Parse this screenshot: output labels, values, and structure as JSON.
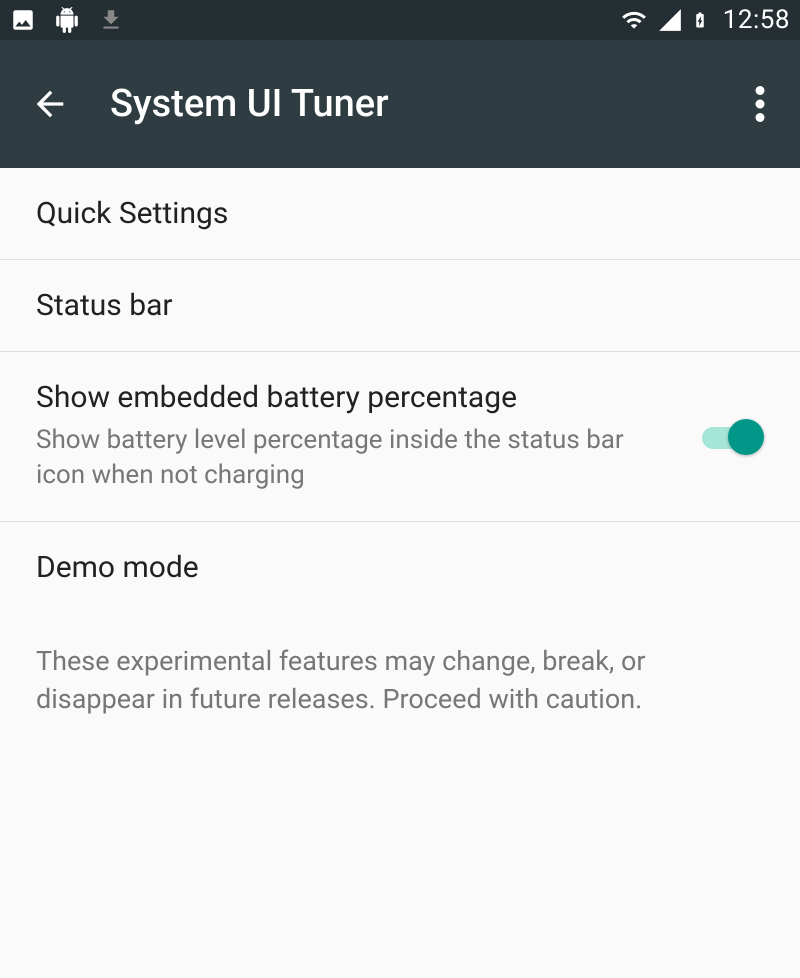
{
  "status_bar": {
    "time": "12:58"
  },
  "app_bar": {
    "title": "System UI Tuner"
  },
  "items": [
    {
      "title": "Quick Settings"
    },
    {
      "title": "Status bar"
    },
    {
      "title": "Show embedded battery percentage",
      "subtitle": "Show battery level percentage inside the status bar icon when not charging",
      "toggle": true,
      "toggle_on": true
    },
    {
      "title": "Demo mode"
    }
  ],
  "footer": "These experimental features may change, break, or disappear in future releases. Proceed with caution."
}
